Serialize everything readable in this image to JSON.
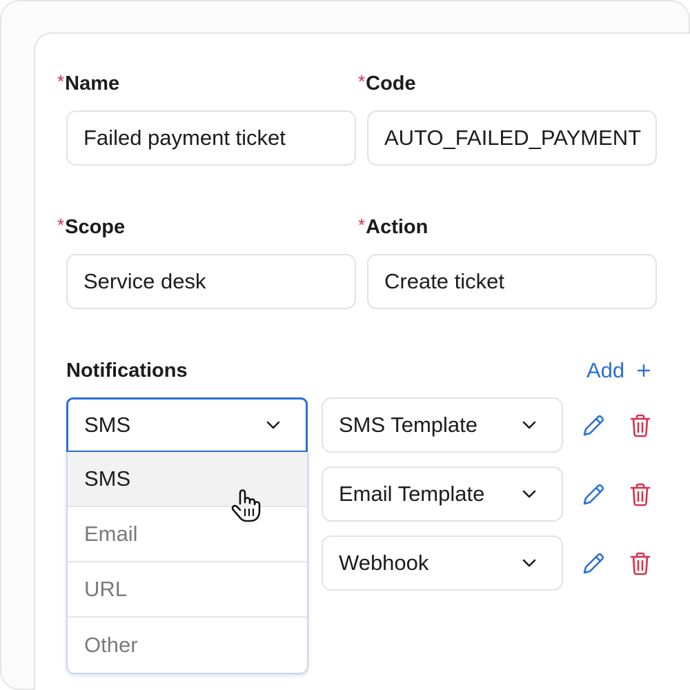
{
  "form": {
    "required_mark": "*",
    "name": {
      "label": "Name",
      "value": "Failed payment ticket"
    },
    "code": {
      "label": "Code",
      "value": "AUTO_FAILED_PAYMENT"
    },
    "scope": {
      "label": "Scope",
      "value": "Service desk"
    },
    "action": {
      "label": "Action",
      "value": "Create ticket"
    }
  },
  "notifications": {
    "heading": "Notifications",
    "add_label": "Add",
    "add_icon": "plus-icon",
    "rows": [
      {
        "channel": "SMS",
        "template": "SMS Template"
      },
      {
        "template": "Email Template"
      },
      {
        "template": "Webhook"
      }
    ],
    "channel_options": [
      "SMS",
      "Email",
      "URL",
      "Other"
    ],
    "selected_option": "SMS"
  },
  "colors": {
    "accent": "#2a6fd6",
    "danger": "#d9304a",
    "required": "#d9304a"
  }
}
